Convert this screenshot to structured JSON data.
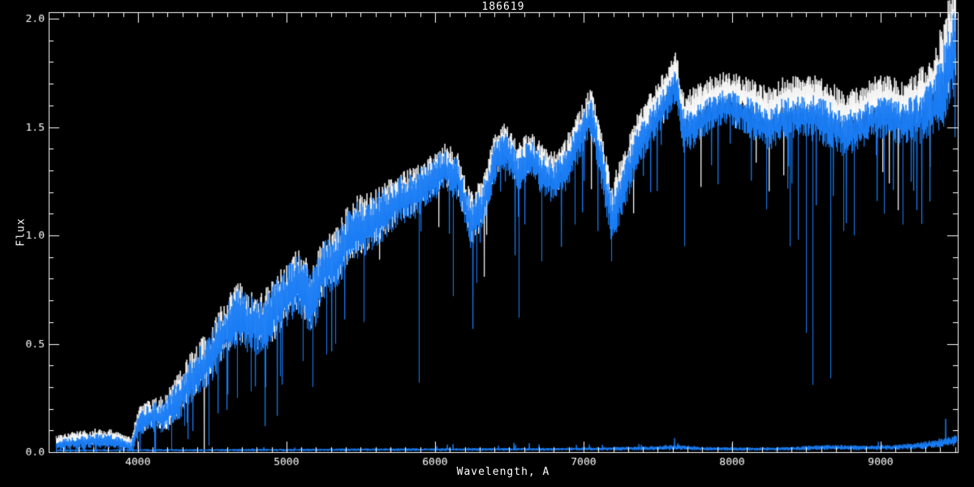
{
  "window": {
    "background": "#000000"
  },
  "chart_data": {
    "type": "line",
    "title": "186619",
    "xlabel": "Wavelength, A",
    "ylabel": "Flux",
    "xlim": [
      3400,
      9519
    ],
    "ylim": [
      0,
      2.03
    ],
    "x_major_ticks": [
      4000,
      5000,
      6000,
      7000,
      8000,
      9000
    ],
    "x_tick_labels": [
      "4000",
      "5000",
      "6000",
      "7000",
      "8000",
      "9000"
    ],
    "x_minor_step": 100,
    "y_major_ticks": [
      0,
      0.5,
      1,
      1.5,
      2
    ],
    "y_tick_labels": [
      "0.0",
      "0.5",
      "1.0",
      "1.5",
      "2.0"
    ],
    "y_minor_step": 0.1,
    "grid": false,
    "legend": "none",
    "background": "#000000",
    "axis_color": "#ffffff",
    "series": [
      {
        "name": "template-spectrum",
        "color": "#ffffff",
        "anchors": [
          [
            3450,
            0.05,
            0.03
          ],
          [
            3550,
            0.06,
            0.03
          ],
          [
            3700,
            0.07,
            0.035
          ],
          [
            3820,
            0.07,
            0.035
          ],
          [
            3900,
            0.055,
            0.03
          ],
          [
            3955,
            0.04,
            0.025
          ],
          [
            4000,
            0.14,
            0.055
          ],
          [
            4080,
            0.18,
            0.065
          ],
          [
            4180,
            0.18,
            0.075
          ],
          [
            4280,
            0.27,
            0.095
          ],
          [
            4380,
            0.37,
            0.105
          ],
          [
            4480,
            0.44,
            0.115
          ],
          [
            4580,
            0.57,
            0.125
          ],
          [
            4680,
            0.65,
            0.125
          ],
          [
            4760,
            0.6,
            0.135
          ],
          [
            4840,
            0.6,
            0.125
          ],
          [
            4920,
            0.67,
            0.135
          ],
          [
            5000,
            0.74,
            0.135
          ],
          [
            5080,
            0.8,
            0.135
          ],
          [
            5170,
            0.7,
            0.145
          ],
          [
            5250,
            0.86,
            0.125
          ],
          [
            5350,
            0.92,
            0.125
          ],
          [
            5450,
            1.04,
            0.135
          ],
          [
            5560,
            1.06,
            0.125
          ],
          [
            5660,
            1.12,
            0.115
          ],
          [
            5760,
            1.18,
            0.105
          ],
          [
            5860,
            1.2,
            0.105
          ],
          [
            5960,
            1.27,
            0.095
          ],
          [
            6060,
            1.33,
            0.095
          ],
          [
            6150,
            1.29,
            0.095
          ],
          [
            6240,
            1.08,
            0.115
          ],
          [
            6320,
            1.15,
            0.105
          ],
          [
            6400,
            1.36,
            0.095
          ],
          [
            6470,
            1.43,
            0.085
          ],
          [
            6560,
            1.32,
            0.095
          ],
          [
            6640,
            1.4,
            0.085
          ],
          [
            6720,
            1.33,
            0.095
          ],
          [
            6800,
            1.29,
            0.095
          ],
          [
            6880,
            1.35,
            0.095
          ],
          [
            6960,
            1.47,
            0.085
          ],
          [
            7050,
            1.6,
            0.085
          ],
          [
            7130,
            1.34,
            0.105
          ],
          [
            7190,
            1.13,
            0.115
          ],
          [
            7260,
            1.26,
            0.105
          ],
          [
            7350,
            1.45,
            0.095
          ],
          [
            7450,
            1.57,
            0.085
          ],
          [
            7550,
            1.67,
            0.085
          ],
          [
            7620,
            1.77,
            0.085
          ],
          [
            7670,
            1.56,
            0.105
          ],
          [
            7740,
            1.58,
            0.095
          ],
          [
            7850,
            1.64,
            0.085
          ],
          [
            7950,
            1.67,
            0.085
          ],
          [
            8050,
            1.65,
            0.085
          ],
          [
            8150,
            1.62,
            0.095
          ],
          [
            8250,
            1.58,
            0.095
          ],
          [
            8350,
            1.63,
            0.095
          ],
          [
            8450,
            1.64,
            0.095
          ],
          [
            8550,
            1.63,
            0.105
          ],
          [
            8650,
            1.6,
            0.105
          ],
          [
            8750,
            1.56,
            0.105
          ],
          [
            8850,
            1.58,
            0.095
          ],
          [
            8950,
            1.63,
            0.095
          ],
          [
            9050,
            1.64,
            0.095
          ],
          [
            9150,
            1.6,
            0.105
          ],
          [
            9250,
            1.64,
            0.115
          ],
          [
            9350,
            1.7,
            0.135
          ],
          [
            9430,
            1.82,
            0.185
          ],
          [
            9505,
            1.98,
            0.225
          ]
        ],
        "spike_rate": 0.03,
        "spike_dir": -1
      },
      {
        "name": "observed-spectrum",
        "color": "#1a7df5",
        "anchors": [
          [
            3450,
            0.03,
            0.025
          ],
          [
            3550,
            0.04,
            0.025
          ],
          [
            3700,
            0.05,
            0.03
          ],
          [
            3820,
            0.05,
            0.03
          ],
          [
            3900,
            0.035,
            0.025
          ],
          [
            3955,
            0.02,
            0.02
          ],
          [
            4000,
            0.12,
            0.05
          ],
          [
            4080,
            0.16,
            0.06
          ],
          [
            4180,
            0.16,
            0.07
          ],
          [
            4280,
            0.25,
            0.09
          ],
          [
            4380,
            0.35,
            0.1
          ],
          [
            4480,
            0.42,
            0.11
          ],
          [
            4580,
            0.55,
            0.12
          ],
          [
            4680,
            0.63,
            0.12
          ],
          [
            4760,
            0.58,
            0.13
          ],
          [
            4840,
            0.58,
            0.12
          ],
          [
            4920,
            0.65,
            0.13
          ],
          [
            5000,
            0.72,
            0.13
          ],
          [
            5080,
            0.78,
            0.13
          ],
          [
            5170,
            0.68,
            0.14
          ],
          [
            5250,
            0.84,
            0.12
          ],
          [
            5350,
            0.9,
            0.12
          ],
          [
            5450,
            1.02,
            0.13
          ],
          [
            5560,
            1.04,
            0.12
          ],
          [
            5660,
            1.1,
            0.11
          ],
          [
            5760,
            1.16,
            0.1
          ],
          [
            5860,
            1.18,
            0.1
          ],
          [
            5960,
            1.24,
            0.09
          ],
          [
            6060,
            1.3,
            0.09
          ],
          [
            6150,
            1.26,
            0.09
          ],
          [
            6240,
            1.05,
            0.11
          ],
          [
            6320,
            1.12,
            0.1
          ],
          [
            6400,
            1.33,
            0.09
          ],
          [
            6470,
            1.4,
            0.08
          ],
          [
            6560,
            1.28,
            0.09
          ],
          [
            6640,
            1.36,
            0.08
          ],
          [
            6720,
            1.28,
            0.09
          ],
          [
            6800,
            1.24,
            0.09
          ],
          [
            6880,
            1.3,
            0.09
          ],
          [
            6960,
            1.42,
            0.08
          ],
          [
            7050,
            1.55,
            0.08
          ],
          [
            7130,
            1.28,
            0.1
          ],
          [
            7190,
            1.07,
            0.11
          ],
          [
            7260,
            1.2,
            0.1
          ],
          [
            7350,
            1.38,
            0.09
          ],
          [
            7450,
            1.5,
            0.08
          ],
          [
            7550,
            1.6,
            0.08
          ],
          [
            7620,
            1.7,
            0.08
          ],
          [
            7670,
            1.48,
            0.1
          ],
          [
            7740,
            1.5,
            0.09
          ],
          [
            7850,
            1.56,
            0.08
          ],
          [
            7950,
            1.59,
            0.08
          ],
          [
            8050,
            1.57,
            0.08
          ],
          [
            8150,
            1.53,
            0.09
          ],
          [
            8250,
            1.49,
            0.09
          ],
          [
            8350,
            1.54,
            0.09
          ],
          [
            8450,
            1.55,
            0.09
          ],
          [
            8550,
            1.54,
            0.1
          ],
          [
            8650,
            1.51,
            0.1
          ],
          [
            8750,
            1.47,
            0.1
          ],
          [
            8850,
            1.49,
            0.09
          ],
          [
            8950,
            1.54,
            0.09
          ],
          [
            9050,
            1.55,
            0.09
          ],
          [
            9150,
            1.51,
            0.1
          ],
          [
            9250,
            1.54,
            0.11
          ],
          [
            9350,
            1.58,
            0.13
          ],
          [
            9430,
            1.7,
            0.18
          ],
          [
            9505,
            1.88,
            0.22
          ]
        ],
        "spike_rate": 0.05,
        "spike_dir": -1,
        "absorption_lines": [
          [
            3960,
            0.0
          ],
          [
            4226,
            0.01
          ],
          [
            4310,
            0.12
          ],
          [
            4475,
            0.03
          ],
          [
            4668,
            0.25
          ],
          [
            4762,
            0.28
          ],
          [
            4861,
            0.3
          ],
          [
            4957,
            0.35
          ],
          [
            5110,
            0.42
          ],
          [
            5178,
            0.3
          ],
          [
            5270,
            0.45
          ],
          [
            5330,
            0.5
          ],
          [
            5520,
            0.6
          ],
          [
            5890,
            0.32
          ],
          [
            6122,
            0.72
          ],
          [
            6280,
            0.78
          ],
          [
            6563,
            0.62
          ],
          [
            6717,
            0.88
          ],
          [
            6940,
            1.05
          ],
          [
            7185,
            0.88
          ],
          [
            7680,
            0.95
          ],
          [
            8230,
            1.12
          ],
          [
            8390,
            0.95
          ],
          [
            8440,
            0.98
          ],
          [
            8498,
            0.55
          ],
          [
            8542,
            0.31
          ],
          [
            8662,
            0.34
          ],
          [
            8750,
            1.02
          ],
          [
            8820,
            1.0
          ],
          [
            9020,
            1.1
          ],
          [
            9150,
            1.05
          ]
        ]
      },
      {
        "name": "error-spectrum",
        "color": "#1a7df5",
        "anchors": [
          [
            3450,
            0.008,
            0.004
          ],
          [
            5000,
            0.01,
            0.005
          ],
          [
            6000,
            0.012,
            0.006
          ],
          [
            6800,
            0.013,
            0.006
          ],
          [
            7500,
            0.018,
            0.009
          ],
          [
            7650,
            0.022,
            0.011
          ],
          [
            7800,
            0.016,
            0.008
          ],
          [
            8100,
            0.014,
            0.007
          ],
          [
            8400,
            0.016,
            0.008
          ],
          [
            8650,
            0.022,
            0.011
          ],
          [
            8900,
            0.02,
            0.01
          ],
          [
            9100,
            0.022,
            0.011
          ],
          [
            9300,
            0.032,
            0.016
          ],
          [
            9450,
            0.048,
            0.022
          ],
          [
            9510,
            0.055,
            0.025
          ]
        ],
        "spike_rate": 0.03,
        "spike_dir": 1
      }
    ]
  }
}
